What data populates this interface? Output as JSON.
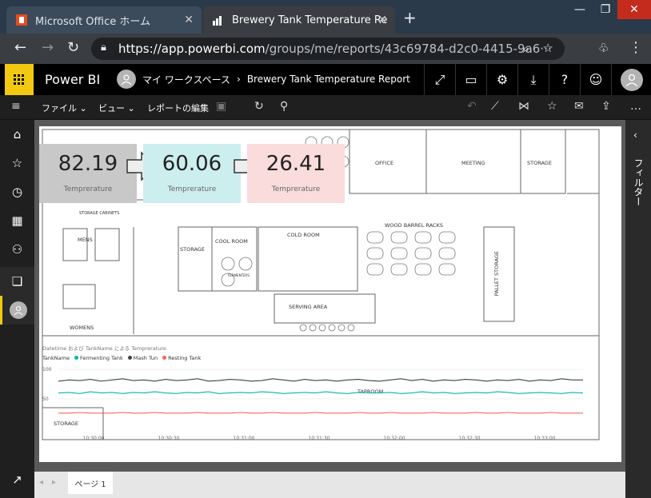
{
  "browser": {
    "tabs": [
      {
        "label": "Microsoft Office ホーム"
      },
      {
        "label": "Brewery Tank Temperature Re"
      }
    ],
    "url_host": "https://app.powerbi.com",
    "url_path": "/groups/me/reports/43c69784-d2c0-4415-9a6···"
  },
  "app": {
    "title": "Power BI",
    "workspace": "マイ ワークスペース",
    "report_title": "Brewery Tank Temperature Report"
  },
  "commands": {
    "file": "ファイル",
    "view": "ビュー",
    "edit": "レポートの編集"
  },
  "filter_pane": {
    "label": "フィルター"
  },
  "cards": [
    {
      "value": "82.19",
      "label": "Temprerature",
      "color": "#c8c8c8"
    },
    {
      "value": "60.06",
      "label": "Temprerature",
      "color": "#cdeeee"
    },
    {
      "value": "26.41",
      "label": "Temprerature",
      "color": "#fadcdc"
    }
  ],
  "floorplan": {
    "office": "OFFICE",
    "meeting": "MEETING",
    "storage_top": "STORAGE",
    "wood_barrel": "WOOD BARREL RACKS",
    "mens": "MENS",
    "storage_cabinets": "STORAGE CABINETS",
    "storage_left": "STORAGE",
    "cool_room": "COOL ROOM",
    "cold_room": "COLD ROOM",
    "pallet_storage": "PALLET STORAGE",
    "serving_area": "SERVING AREA",
    "womens": "WOMENS",
    "taproom": "TAPROOM",
    "storage_bottom": "STORAGE",
    "fermenters": "FERMENTERS"
  },
  "chart_data": {
    "type": "line",
    "title": "Datetime および TankName による Temprerature",
    "legend_title": "TankName",
    "legend_position": "top-left",
    "x": [
      "10:30:00",
      "10:30:30",
      "10:31:00",
      "10:31:30",
      "10:32:00",
      "10:32:30",
      "10:33:00"
    ],
    "ylim": [
      0,
      100
    ],
    "yticks": [
      "100",
      "50"
    ],
    "series": [
      {
        "name": "Fermenting Tank",
        "color": "#01b8aa",
        "values": [
          60,
          61,
          59,
          62,
          60,
          61,
          59,
          61,
          60,
          62,
          60,
          59,
          61,
          60,
          62,
          59,
          60,
          61,
          60,
          62,
          61,
          59,
          60,
          61,
          60,
          62,
          60,
          59,
          61,
          60,
          60,
          61,
          59,
          60,
          62,
          60,
          61,
          59,
          60,
          61,
          60,
          62,
          61,
          59,
          60,
          61,
          60,
          59,
          61,
          60
        ]
      },
      {
        "name": "Mash Tun",
        "color": "#374649",
        "values": [
          80,
          82,
          81,
          83,
          80,
          82,
          84,
          81,
          82,
          80,
          83,
          81,
          82,
          84,
          80,
          81,
          83,
          82,
          80,
          81,
          84,
          82,
          80,
          83,
          81,
          82,
          80,
          82,
          83,
          81,
          80,
          82,
          84,
          81,
          83,
          80,
          82,
          81,
          83,
          82,
          80,
          82,
          81,
          83,
          80,
          82,
          81,
          84,
          82,
          82
        ]
      },
      {
        "name": "Resting Tank",
        "color": "#fd625e",
        "values": [
          26,
          26,
          27,
          26,
          26,
          26,
          27,
          26,
          26,
          27,
          26,
          26,
          26,
          27,
          26,
          26,
          26,
          27,
          26,
          26,
          27,
          26,
          26,
          26,
          27,
          26,
          26,
          26,
          27,
          26,
          26,
          27,
          26,
          26,
          26,
          27,
          26,
          26,
          26,
          27,
          26,
          26,
          27,
          26,
          26,
          26,
          27,
          26,
          26,
          26
        ]
      }
    ]
  },
  "pages": [
    {
      "label": "ページ 1"
    }
  ]
}
